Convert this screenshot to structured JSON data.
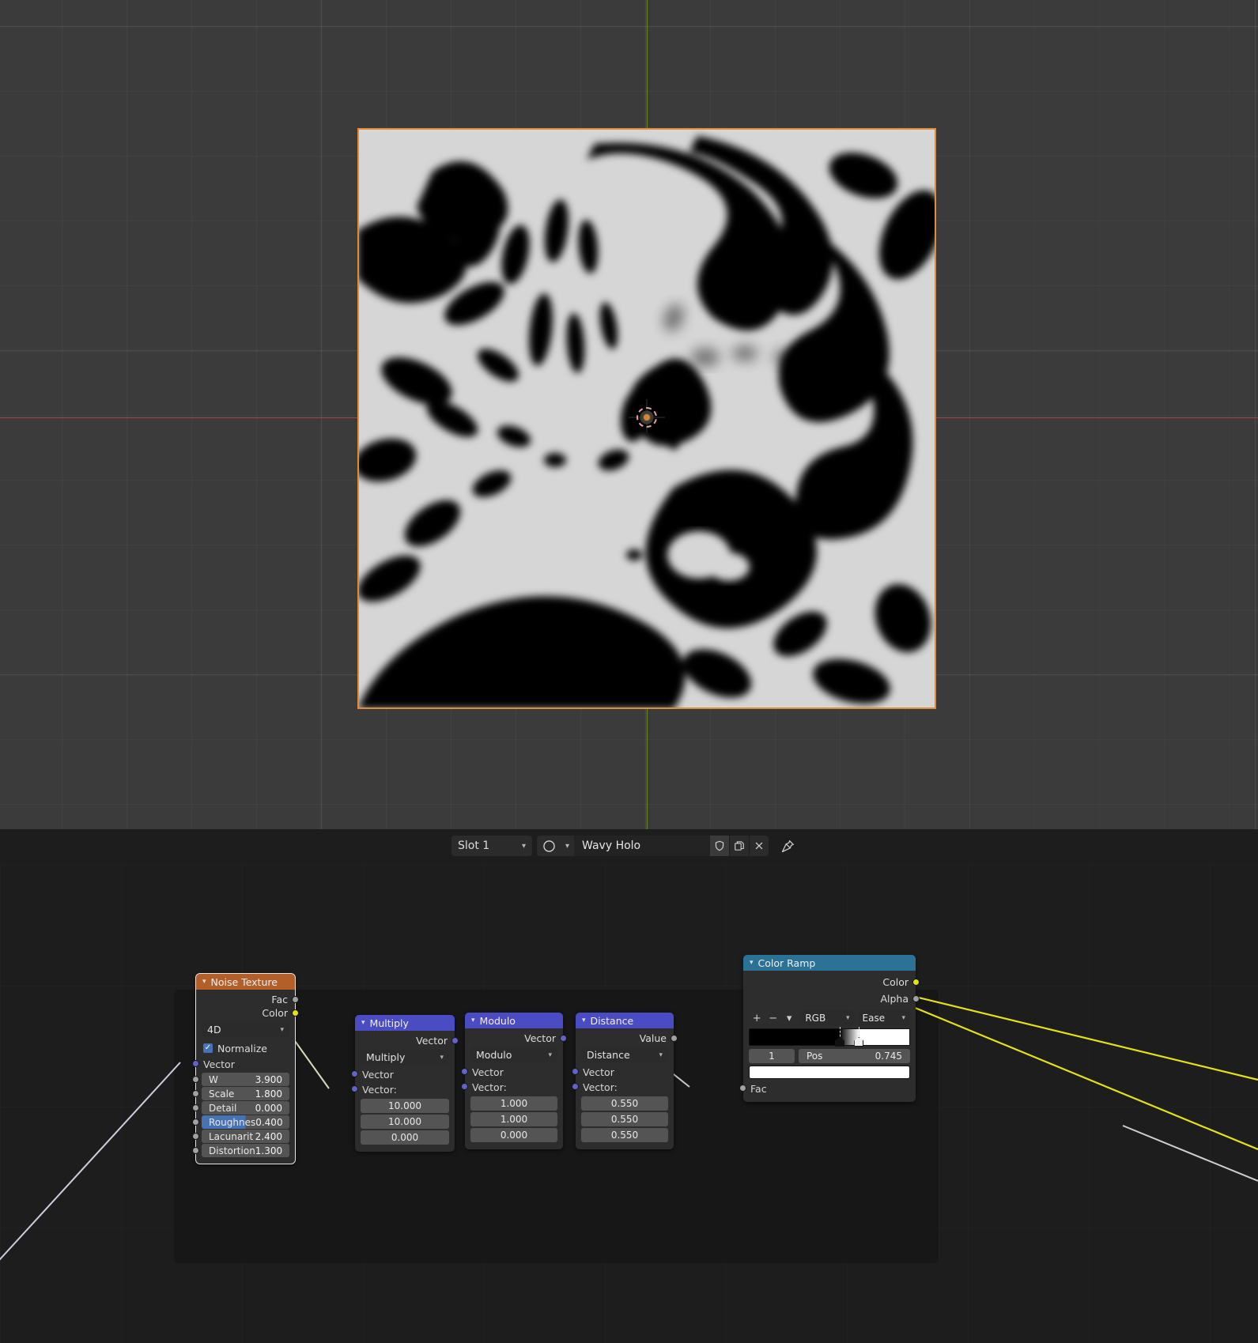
{
  "app": "blender-shader-editor",
  "viewport": {
    "name": "3d-viewport",
    "background_color": "#3b3b3b",
    "grid_color": "#4a4a4a",
    "axis_x_color": "#a3444b",
    "axis_y_color": "#6a8a29",
    "object_outline_color": "#e08c3c",
    "cursor_label": "3d-cursor"
  },
  "headerbar": {
    "slot_label": "Slot 1",
    "material_name": "Wavy Holo",
    "icons": {
      "material_preview": "material-sphere-icon",
      "fake_user": "shield-icon",
      "new_material": "duplicate-icon",
      "unlink": "close-icon",
      "pin": "pin-icon",
      "slot_chevron": "chevron-down-icon",
      "browse_chevron": "chevron-down-icon"
    }
  },
  "node_editor": {
    "nodes": [
      {
        "id": "noise-texture",
        "title": "Noise Texture",
        "header_color": "#b35f2a",
        "selected": true,
        "outputs": [
          {
            "label": "Fac",
            "socket": "gray"
          },
          {
            "label": "Color",
            "socket": "yellow"
          }
        ],
        "dimension": "4D",
        "normalize_label": "Normalize",
        "normalize_checked": true,
        "vector_input": "Vector",
        "properties": [
          {
            "label": "W",
            "value": "3.900",
            "highlight": false
          },
          {
            "label": "Scale",
            "value": "1.800",
            "highlight": false
          },
          {
            "label": "Detail",
            "value": "0.000",
            "highlight": false
          },
          {
            "label": "Roughnes",
            "value": "0.400",
            "highlight": true
          },
          {
            "label": "Lacunarit",
            "value": "2.400",
            "highlight": false
          },
          {
            "label": "Distortion",
            "value": "1.300",
            "highlight": false
          }
        ]
      },
      {
        "id": "vector-math-multiply",
        "title": "Multiply",
        "header_color": "#4b4bc4",
        "selected": false,
        "output_label": "Vector",
        "operation": "Multiply",
        "input_a_label": "Vector",
        "input_b_label": "Vector:",
        "vector_values": [
          "10.000",
          "10.000",
          "0.000"
        ]
      },
      {
        "id": "vector-math-modulo",
        "title": "Modulo",
        "header_color": "#4b4bc4",
        "selected": false,
        "output_label": "Vector",
        "operation": "Modulo",
        "input_a_label": "Vector",
        "input_b_label": "Vector:",
        "vector_values": [
          "1.000",
          "1.000",
          "0.000"
        ]
      },
      {
        "id": "vector-math-distance",
        "title": "Distance",
        "header_color": "#4b4bc4",
        "selected": false,
        "output_label": "Value",
        "operation": "Distance",
        "input_a_label": "Vector",
        "input_b_label": "Vector:",
        "vector_values": [
          "0.550",
          "0.550",
          "0.550"
        ]
      },
      {
        "id": "color-ramp",
        "title": "Color Ramp",
        "header_color": "#2b7296",
        "selected": false,
        "outputs": [
          {
            "label": "Color",
            "socket": "yellow"
          },
          {
            "label": "Alpha",
            "socket": "gray"
          }
        ],
        "tools": {
          "add": "+",
          "remove": "−",
          "menu": "chevron-down-icon"
        },
        "color_mode": "RGB",
        "interpolation": "Ease",
        "stop_index": "1",
        "pos_label": "Pos",
        "pos_value": "0.745",
        "stop_color": "#ffffff",
        "input_label": "Fac",
        "gradient": {
          "start_color": "#000000",
          "end_color": "#ffffff",
          "stop_positions": [
            0.565,
            0.685
          ]
        }
      }
    ],
    "links": [
      {
        "from": "offscreen-left",
        "to": "noise-texture.Vector",
        "color": "#c8c8d8"
      },
      {
        "from": "noise-texture.Color",
        "to": "multiply.Vector",
        "color": "#d8d8c8"
      },
      {
        "from": "multiply.Vector",
        "to": "modulo.Vector",
        "color": "#8a8ad0"
      },
      {
        "from": "modulo.Vector",
        "to": "distance.Vector",
        "color": "#8a8ad0"
      },
      {
        "from": "distance.Value",
        "to": "color-ramp.Fac",
        "color": "#c8c8c8"
      },
      {
        "from": "color-ramp.Color",
        "to": "offscreen-right-a",
        "color": "#e2e215"
      },
      {
        "from": "color-ramp.Color",
        "to": "offscreen-right-b",
        "color": "#e2e215"
      }
    ]
  }
}
